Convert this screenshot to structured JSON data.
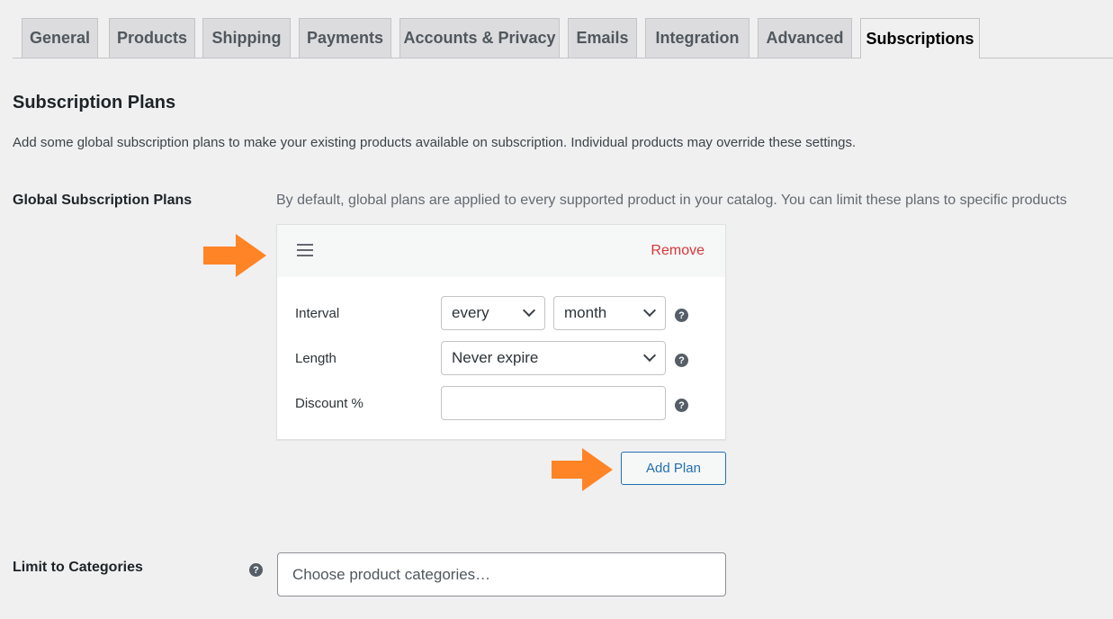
{
  "tabs": [
    {
      "label": "General"
    },
    {
      "label": "Products"
    },
    {
      "label": "Shipping"
    },
    {
      "label": "Payments"
    },
    {
      "label": "Accounts & Privacy"
    },
    {
      "label": "Emails"
    },
    {
      "label": "Integration"
    },
    {
      "label": "Advanced"
    },
    {
      "label": "Subscriptions",
      "active": true
    }
  ],
  "section": {
    "title": "Subscription Plans",
    "description": "Add some global subscription plans to make your existing products available on subscription. Individual products may override these settings."
  },
  "global_plans": {
    "label": "Global Subscription Plans",
    "description": "By default, global plans are applied to every supported product in your catalog. You can limit these plans to specific products",
    "plan": {
      "remove_label": "Remove",
      "interval_label": "Interval",
      "interval_every": "every",
      "interval_period": "month",
      "length_label": "Length",
      "length_value": "Never expire",
      "discount_label": "Discount %",
      "discount_value": ""
    },
    "add_plan_label": "Add Plan"
  },
  "categories": {
    "label": "Limit to Categories",
    "placeholder": "Choose product categories…"
  },
  "colors": {
    "accent": "#2271b1",
    "remove": "#d63638",
    "arrow": "#ff8426"
  }
}
